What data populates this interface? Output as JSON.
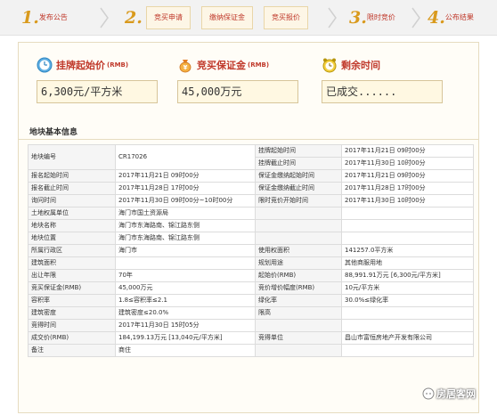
{
  "steps": [
    {
      "num": "1.",
      "label": "发布公告"
    },
    {
      "num": "2.",
      "label": "竞买申请"
    },
    {
      "num": "",
      "label": "缴纳保证金"
    },
    {
      "num": "",
      "label": "竞买报价"
    },
    {
      "num": "3.",
      "label": "限时竞价"
    },
    {
      "num": "4.",
      "label": "公布结果"
    }
  ],
  "cards": {
    "start_price": {
      "title": "挂牌起始价",
      "sub": "(RMB)",
      "value": "6,300元/平方米"
    },
    "deposit": {
      "title": "竞买保证金",
      "sub": "(RMB)",
      "value": "45,000万元"
    },
    "remaining": {
      "title": "剩余时间",
      "value": "已成交......"
    }
  },
  "section_title": "地块基本信息",
  "rows": [
    [
      "地块编号",
      "CR17026",
      "挂牌起始时间",
      "2017年11月21日 09时00分"
    ],
    [
      "",
      "",
      "挂牌截止时间",
      "2017年11月30日 10时00分"
    ],
    [
      "报名起始时间",
      "2017年11月21日 09时00分",
      "保证金缴纳起始时间",
      "2017年11月21日 09时00分"
    ],
    [
      "报名截止时间",
      "2017年11月28日 17时00分",
      "保证金缴纳截止时间",
      "2017年11月28日 17时00分"
    ],
    [
      "询问时间",
      "2017年11月30日 09时00分~10时00分",
      "限时竞价开始时间",
      "2017年11月30日 10时00分"
    ],
    [
      "土地权属单位",
      "海门市国土资源局",
      "",
      ""
    ],
    [
      "地块名称",
      "海门市东海路南、锦江路东侧",
      "",
      ""
    ],
    [
      "地块位置",
      "海门市东海路南、锦江路东侧",
      "",
      ""
    ],
    [
      "所属行政区",
      "海门市",
      "使用权面积",
      "141257.0平方米"
    ],
    [
      "建筑面积",
      "",
      "规划用途",
      "其他商服用地"
    ],
    [
      "出让年限",
      "70年",
      "起始价(RMB)",
      "88,991.91万元 [6,300元/平方米]"
    ],
    [
      "竞买保证金(RMB)",
      "45,000万元",
      "竞价增价幅度(RMB)",
      "10元/平方米"
    ],
    [
      "容积率",
      "1.8≤容积率≤2.1",
      "绿化率",
      "30.0%≤绿化率"
    ],
    [
      "建筑密度",
      "建筑密度≤20.0%",
      "限高",
      ""
    ],
    [
      "竞得时间",
      "2017年11月30日 15时05分",
      "",
      ""
    ],
    [
      "成交价(RMB)",
      "184,199.13万元 [13,040元/平方米]",
      "竞得单位",
      "昌山市富恒房地产开发有限公司"
    ],
    [
      "备注",
      "商住",
      "",
      ""
    ]
  ],
  "watermark": "房居客网",
  "colors": {
    "accent": "#c0392b",
    "step_number": "#d99a1d",
    "card_bg": "#fff8e2",
    "border": "#e6dcc0"
  }
}
